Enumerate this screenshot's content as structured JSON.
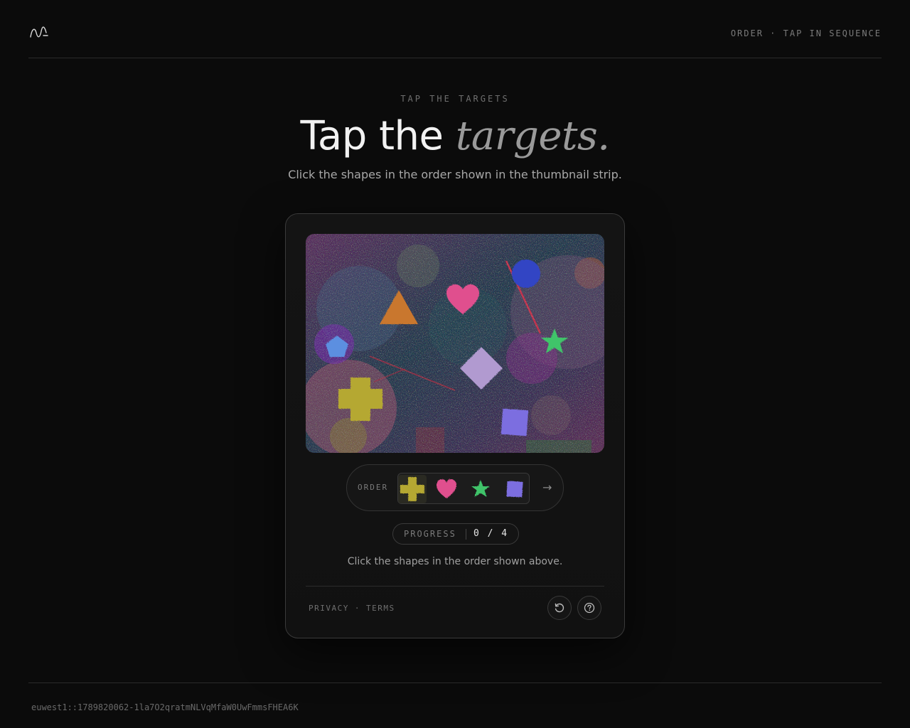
{
  "header": {
    "logo_icon": "wave-logo-icon",
    "tag": "ORDER · TAP IN SEQUENCE"
  },
  "hero": {
    "eyebrow": "TAP THE TARGETS",
    "headline_plain": "Tap the",
    "headline_emphasis": "targets.",
    "subhead": "Click the shapes in the order shown in the thumbnail strip."
  },
  "challenge": {
    "shapes": [
      {
        "name": "cross",
        "color": "#b5a832"
      },
      {
        "name": "heart",
        "color": "#e0508e"
      },
      {
        "name": "star",
        "color": "#3fc46a"
      },
      {
        "name": "square",
        "color": "#7b6ee0"
      },
      {
        "name": "triangle",
        "color": "#c9772e"
      },
      {
        "name": "pentagon",
        "color": "#5b8fe0"
      },
      {
        "name": "diamond",
        "color": "#b19ad0"
      },
      {
        "name": "circle",
        "color": "#3145c4"
      }
    ],
    "order_label": "ORDER",
    "order": [
      "cross",
      "heart",
      "star",
      "square"
    ],
    "next_icon": "arrow-right-icon",
    "next_glyph": "→",
    "progress_label": "PROGRESS",
    "progress_value": "0 / 4",
    "progress_done": 0,
    "progress_total": 4,
    "instruction": "Click the shapes in the order shown above."
  },
  "footer_links": {
    "privacy": "PRIVACY",
    "separator": "·",
    "terms": "TERMS"
  },
  "actions": {
    "refresh_icon": "refresh-icon",
    "help_icon": "help-circle-icon"
  },
  "footer": {
    "session_id": "euwest1::1789820062-1la7O2qratmNLVqMfaW0UwFmmsFHEA6K"
  }
}
